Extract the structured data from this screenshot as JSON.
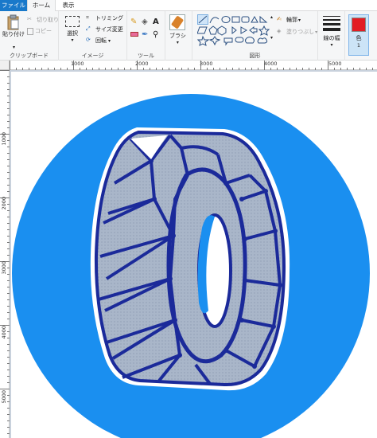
{
  "tabs": {
    "file": "ファイル",
    "home": "ホーム",
    "view": "表示"
  },
  "clipboard": {
    "paste": "貼り付け",
    "cut": "切り取り",
    "copy": "コピー",
    "label": "クリップボード"
  },
  "image": {
    "select": "選択",
    "crop": "トリミング",
    "resize": "サイズ変更",
    "rotate": "回転",
    "label": "イメージ"
  },
  "tools": {
    "label": "ツール"
  },
  "brushes": {
    "label": "ブラシ"
  },
  "shapes": {
    "outline": "輪郭",
    "fill": "塗りつぶし",
    "label": "図形"
  },
  "size": {
    "label": "線の幅"
  },
  "color": {
    "label": "色",
    "index": "1",
    "value": "#e21d24"
  },
  "ruler": {
    "h": [
      "1000",
      "2000",
      "3000",
      "4000",
      "5000"
    ],
    "v": [
      "1000",
      "2000",
      "3000",
      "4000",
      "5000"
    ]
  },
  "colors": {
    "accent": "#1979ca",
    "circle": "#1a8ff0",
    "tire_dark": "#1b2a9a",
    "tire_light": "#a8b5c8"
  }
}
